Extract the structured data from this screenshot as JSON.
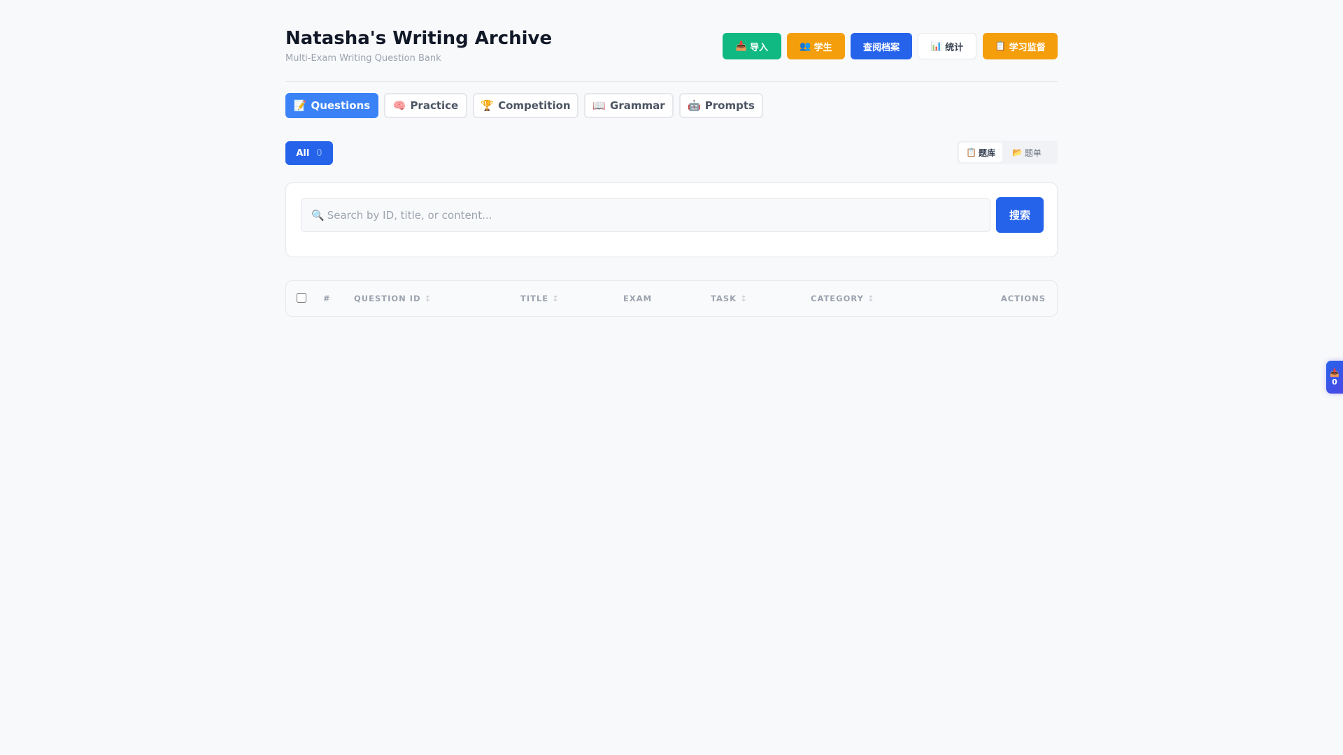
{
  "header": {
    "title": "Natasha's Writing Archive",
    "subtitle": "Multi-Exam Writing Question Bank"
  },
  "actions": [
    {
      "icon": "📥",
      "label": "导入",
      "color": "#10b981"
    },
    {
      "icon": "👥",
      "label": "学生",
      "color": "#f59e0b"
    },
    {
      "icon": "",
      "label": "查阅档案",
      "color": "#2563eb"
    },
    {
      "icon": "📊",
      "label": "统计",
      "color": "#ffffff"
    },
    {
      "icon": "📋",
      "label": "学习监督",
      "color": "#f59e0b"
    }
  ],
  "tabs": [
    {
      "icon": "📝",
      "label": "Questions"
    },
    {
      "icon": "🧠",
      "label": "Practice"
    },
    {
      "icon": "🏆",
      "label": "Competition"
    },
    {
      "icon": "📖",
      "label": "Grammar"
    },
    {
      "icon": "🤖",
      "label": "Prompts"
    }
  ],
  "filter": {
    "label": "All",
    "count": "0"
  },
  "view_toggle": [
    {
      "icon": "📋",
      "label": "题库"
    },
    {
      "icon": "📂",
      "label": "题单"
    }
  ],
  "search": {
    "icon": "🔍",
    "placeholder": "Search by ID, title, or content...",
    "value": "",
    "button": "搜索"
  },
  "table": {
    "columns": [
      "#",
      "QUESTION ID",
      "TITLE",
      "EXAM",
      "TASK",
      "CATEGORY",
      "ACTIONS"
    ],
    "sort_glyph": "↕"
  },
  "float_tray": {
    "icon": "📥",
    "count": "0"
  }
}
